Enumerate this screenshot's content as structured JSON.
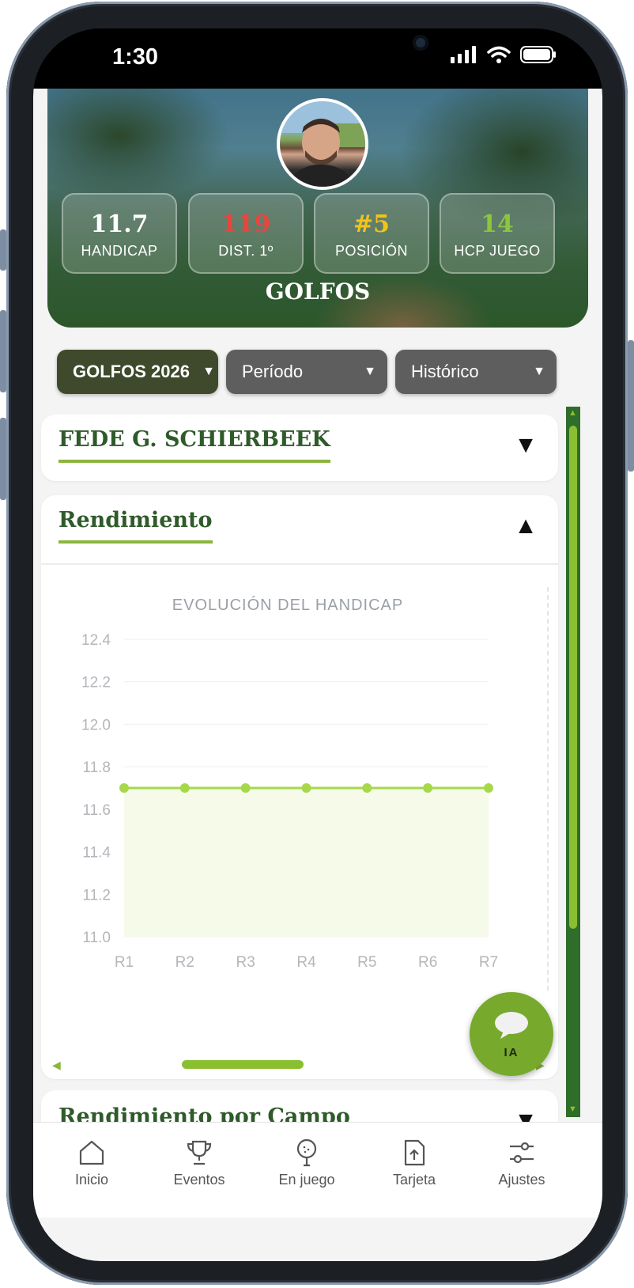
{
  "status_bar": {
    "time": "1:30"
  },
  "hero": {
    "title": "GOLFOS",
    "stats": [
      {
        "value": "11.7",
        "label": "HANDICAP",
        "color": "#ffffff"
      },
      {
        "value": "119",
        "label": "DIST. 1º",
        "color": "#e8453c"
      },
      {
        "value": "#5",
        "label": "POSICIÓN",
        "color": "#f2c418"
      },
      {
        "value": "14",
        "label": "HCP JUEGO",
        "color": "#8cc63f"
      }
    ]
  },
  "filters": {
    "tournament": "GOLFOS 2026",
    "period": "Período",
    "range": "Histórico"
  },
  "player_card": {
    "title": "FEDE G. SCHIERBEEK"
  },
  "performance_card": {
    "title": "Rendimiento"
  },
  "chart_data": {
    "type": "area",
    "title": "EVOLUCIÓN DEL HANDICAP",
    "categories": [
      "R1",
      "R2",
      "R3",
      "R4",
      "R5",
      "R6",
      "R7"
    ],
    "series": [
      {
        "values": [
          11.7,
          11.7,
          11.7,
          11.7,
          11.7,
          11.7,
          11.7
        ]
      }
    ],
    "ylim": [
      11.0,
      12.4
    ],
    "yticks": [
      "12.4",
      "12.2",
      "12.0",
      "11.8",
      "11.6",
      "11.4",
      "11.2",
      "11.0"
    ],
    "grid": true,
    "line_color": "#a7d84a",
    "fill_color": "#f6fae9"
  },
  "next_card": {
    "title": "Rendimiento por Campo"
  },
  "fab": {
    "label": "IA"
  },
  "tabbar": {
    "items": [
      {
        "label": "Inicio",
        "icon": "home-icon"
      },
      {
        "label": "Eventos",
        "icon": "trophy-icon"
      },
      {
        "label": "En juego",
        "icon": "golf-ball-icon"
      },
      {
        "label": "Tarjeta",
        "icon": "upload-card-icon"
      },
      {
        "label": "Ajustes",
        "icon": "sliders-icon"
      }
    ]
  },
  "colors": {
    "brand_green": "#2f5a2a",
    "accent_green": "#8bb63e",
    "filter_dark": "#3f4a2c",
    "filter_gray": "#5e5e5e"
  }
}
